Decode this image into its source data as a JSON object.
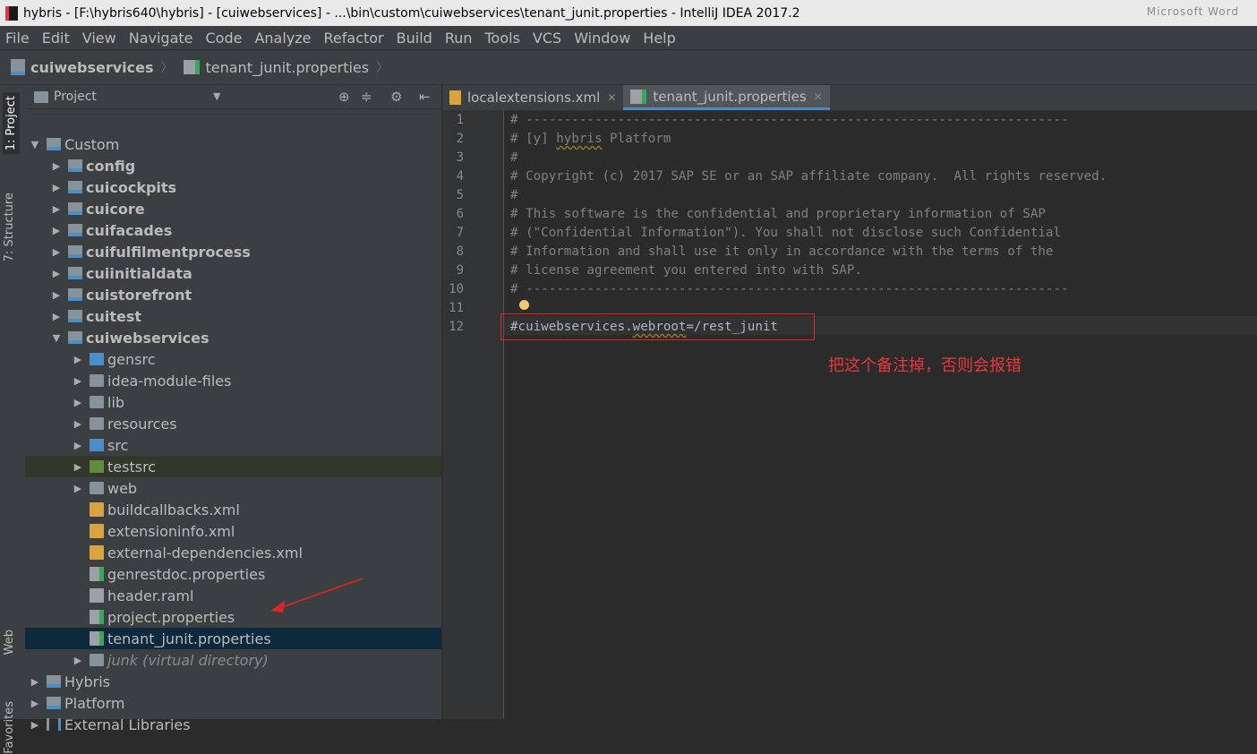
{
  "window": {
    "title": "hybris - [F:\\hybris640\\hybris] - [cuiwebservices] - ...\\bin\\custom\\cuiwebservices\\tenant_junit.properties - IntelliJ IDEA 2017.2",
    "ghost_text": "Microsoft Word"
  },
  "menu": [
    "File",
    "Edit",
    "View",
    "Navigate",
    "Code",
    "Analyze",
    "Refactor",
    "Build",
    "Run",
    "Tools",
    "VCS",
    "Window",
    "Help"
  ],
  "breadcrumb": [
    "cuiwebservices",
    "tenant_junit.properties"
  ],
  "side_tabs": {
    "project": "1: Project",
    "structure": "7: Structure",
    "web": "Web",
    "favorites": "Favorites"
  },
  "project_panel": {
    "title": "Project"
  },
  "tree": [
    {
      "label": "Custom",
      "depth": 0,
      "arrow": "▼",
      "icon": "folder-mod",
      "bold": false
    },
    {
      "label": "config",
      "depth": 1,
      "arrow": "▶",
      "icon": "folder-mod",
      "bold": true
    },
    {
      "label": "cuicockpits",
      "depth": 1,
      "arrow": "▶",
      "icon": "folder-mod",
      "bold": true
    },
    {
      "label": "cuicore",
      "depth": 1,
      "arrow": "▶",
      "icon": "folder-mod",
      "bold": true
    },
    {
      "label": "cuifacades",
      "depth": 1,
      "arrow": "▶",
      "icon": "folder-mod",
      "bold": true
    },
    {
      "label": "cuifulfilmentprocess",
      "depth": 1,
      "arrow": "▶",
      "icon": "folder-mod",
      "bold": true
    },
    {
      "label": "cuiinitialdata",
      "depth": 1,
      "arrow": "▶",
      "icon": "folder-mod",
      "bold": true
    },
    {
      "label": "cuistorefront",
      "depth": 1,
      "arrow": "▶",
      "icon": "folder-mod",
      "bold": true
    },
    {
      "label": "cuitest",
      "depth": 1,
      "arrow": "▶",
      "icon": "folder-mod",
      "bold": true
    },
    {
      "label": "cuiwebservices",
      "depth": 1,
      "arrow": "▼",
      "icon": "folder-mod",
      "bold": true
    },
    {
      "label": "gensrc",
      "depth": 2,
      "arrow": "▶",
      "icon": "folder-src",
      "bold": false
    },
    {
      "label": "idea-module-files",
      "depth": 2,
      "arrow": "▶",
      "icon": "folder",
      "bold": false
    },
    {
      "label": "lib",
      "depth": 2,
      "arrow": "▶",
      "icon": "folder",
      "bold": false
    },
    {
      "label": "resources",
      "depth": 2,
      "arrow": "▶",
      "icon": "folder",
      "bold": false
    },
    {
      "label": "src",
      "depth": 2,
      "arrow": "▶",
      "icon": "folder-src",
      "bold": false
    },
    {
      "label": "testsrc",
      "depth": 2,
      "arrow": "▶",
      "icon": "folder-green",
      "bold": false,
      "highlight": "green"
    },
    {
      "label": "web",
      "depth": 2,
      "arrow": "▶",
      "icon": "folder",
      "bold": false
    },
    {
      "label": "buildcallbacks.xml",
      "depth": 2,
      "arrow": "",
      "icon": "file-xml",
      "bold": false
    },
    {
      "label": "extensioninfo.xml",
      "depth": 2,
      "arrow": "",
      "icon": "file-xml",
      "bold": false
    },
    {
      "label": "external-dependencies.xml",
      "depth": 2,
      "arrow": "",
      "icon": "file-xml",
      "bold": false
    },
    {
      "label": "genrestdoc.properties",
      "depth": 2,
      "arrow": "",
      "icon": "file-prop",
      "bold": false
    },
    {
      "label": "header.raml",
      "depth": 2,
      "arrow": "",
      "icon": "file-raml",
      "bold": false
    },
    {
      "label": "project.properties",
      "depth": 2,
      "arrow": "",
      "icon": "file-prop",
      "bold": false
    },
    {
      "label": "tenant_junit.properties",
      "depth": 2,
      "arrow": "",
      "icon": "file-prop",
      "bold": false,
      "highlight": "selected"
    },
    {
      "label": "junk (virtual directory)",
      "depth": 2,
      "arrow": "▶",
      "icon": "folder",
      "bold": false,
      "italic": true
    },
    {
      "label": "Hybris",
      "depth": 0,
      "arrow": "▶",
      "icon": "folder-mod",
      "bold": false
    },
    {
      "label": "Platform",
      "depth": 0,
      "arrow": "▶",
      "icon": "folder-mod",
      "bold": false
    },
    {
      "label": "External Libraries",
      "depth": 0,
      "arrow": "▶",
      "icon": "libs",
      "bold": false
    }
  ],
  "editor_tabs": [
    {
      "label": "localextensions.xml",
      "active": false,
      "icon": "file-xml"
    },
    {
      "label": "tenant_junit.properties",
      "active": true,
      "icon": "file-prop"
    }
  ],
  "code_lines": [
    "# -----------------------------------------------------------------------",
    "# [y] hybris Platform",
    "#",
    "# Copyright (c) 2017 SAP SE or an SAP affiliate company.  All rights reserved.",
    "#",
    "# This software is the confidential and proprietary information of SAP",
    "# (\"Confidential Information\"). You shall not disclose such Confidential",
    "# Information and shall use it only in accordance with the terms of the",
    "# license agreement you entered into with SAP.",
    "# -----------------------------------------------------------------------",
    "",
    "#cuiwebservices.webroot=/rest_junit"
  ],
  "annotation": "把这个备注掉，否则会报错",
  "colors": {
    "accent": "#4a88c7",
    "annotation_red": "#e8383d",
    "selection": "#0d293e"
  }
}
